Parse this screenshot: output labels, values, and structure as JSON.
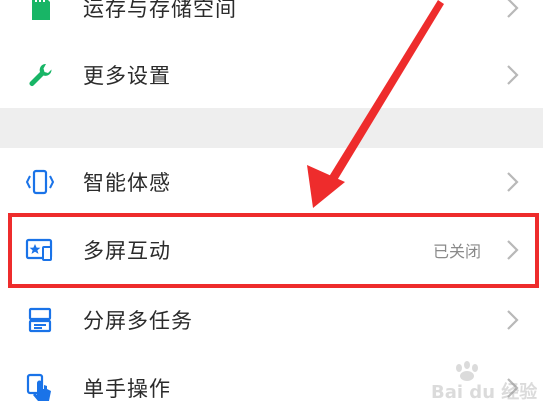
{
  "settings": {
    "items": [
      {
        "label": "运存与存储空间",
        "value": "",
        "icon": "storage-icon"
      },
      {
        "label": "更多设置",
        "value": "",
        "icon": "wrench-icon"
      },
      {
        "label": "智能体感",
        "value": "",
        "icon": "phone-motion-icon"
      },
      {
        "label": "多屏互动",
        "value": "已关闭",
        "icon": "cast-screen-icon"
      },
      {
        "label": "分屏多任务",
        "value": "",
        "icon": "split-screen-icon"
      },
      {
        "label": "单手操作",
        "value": "",
        "icon": "one-hand-icon"
      }
    ]
  },
  "colors": {
    "accent": "#1a73e8",
    "green": "#18b566",
    "annotation_red": "#ee2c2c",
    "chevron": "#b8b8b8",
    "section_gap": "#eeeeee"
  },
  "watermark": {
    "text": "Bai du 经验"
  }
}
